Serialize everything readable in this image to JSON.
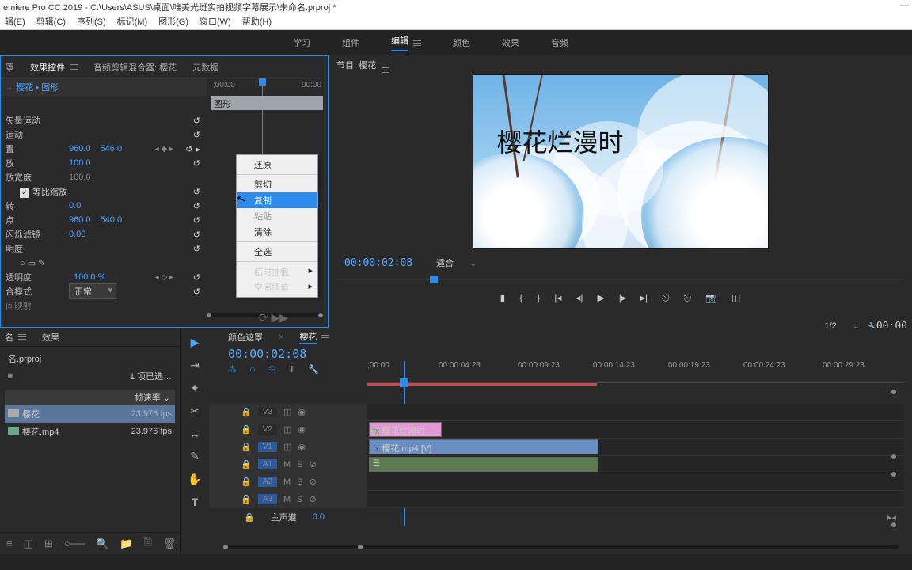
{
  "titlebar": {
    "title": "emiere Pro CC 2019 - C:\\Users\\ASUS\\桌面\\唯美光斑实拍视频字幕展示\\未命名.prproj *",
    "minimize": "—"
  },
  "menubar": {
    "edit": "辑(E)",
    "clip": "剪辑(C)",
    "sequence": "序列(S)",
    "marker": "标记(M)",
    "graphics": "图形(G)",
    "window": "窗口(W)",
    "help": "帮助(H)"
  },
  "workspaces": {
    "learn": "学习",
    "assembly": "组件",
    "editing": "编辑",
    "color": "颜色",
    "effects": "效果",
    "audio": "音频"
  },
  "effects_panel": {
    "tab0": "罩",
    "tab1": "效果控件",
    "tab2": "音频剪辑混合器: 樱花",
    "tab3": "元数据",
    "clip_chain": "樱花 • 图形",
    "tl_start": ";00:00",
    "tl_end": "00:00",
    "clip_name": "图形",
    "motion": "矢量运动",
    "anim": "运动",
    "pos_lbl": "置",
    "pos_x": "960.0",
    "pos_y": "546.0",
    "scale_lbl": "放",
    "scale": "100.0",
    "scalew_lbl": "放宽度",
    "scalew": "100.0",
    "uniform": "等比缩放",
    "rot_lbl": "转",
    "rot": "0.0",
    "anchor_lbl": "点",
    "anchor_x": "960.0",
    "anchor_y": "540.0",
    "flicker_lbl": "闪烁滤镜",
    "flicker": "0.00",
    "opacity_lbl": "明度",
    "op_pct_lbl": "透明度",
    "op_pct": "100.0 %",
    "blend_lbl": "合模式",
    "blend": "正常",
    "remap_lbl": "间映射"
  },
  "program": {
    "title": "节目: 樱花",
    "overlay": "樱花烂漫时",
    "tc": "00:00:02:08",
    "fit": "适合",
    "res": "1/2",
    "tc_end": "00:00"
  },
  "project": {
    "tab0": "名",
    "tab1": "效果",
    "file": "名.prproj",
    "count": "1 项已选…",
    "col_fps": "帧速率",
    "item0": "樱花",
    "item0_fps": "23.976 fps",
    "item1": "樱花.mp4",
    "item1_fps": "23.976 fps"
  },
  "timeline": {
    "tab0": "颜色遮罩",
    "tab1": "樱花",
    "tc": "00:00:02:08",
    "ruler": [
      ";00:00",
      "00:00:04:23",
      "00:00:09:23",
      "00:00:14:23",
      "00:00:19:23",
      "00:00:24:23",
      "00:00:29:23"
    ],
    "v3": "V3",
    "v2": "V2",
    "v1": "V1",
    "a1": "A1",
    "a2": "A2",
    "a3": "A3",
    "clip_gfx": "樱花烂漫时",
    "clip_vid": "樱花.mp4 [V]",
    "fx": "fx",
    "master": "主声道",
    "master_val": "0.0",
    "M": "M",
    "S": "S",
    "eye": "◉",
    "lock": "🔒"
  },
  "context_menu": {
    "restore": "还原",
    "cut": "剪切",
    "copy": "复制",
    "paste": "粘贴",
    "clear": "清除",
    "select_all": "全选",
    "temporal": "临时插值",
    "spatial": "空间插值"
  }
}
